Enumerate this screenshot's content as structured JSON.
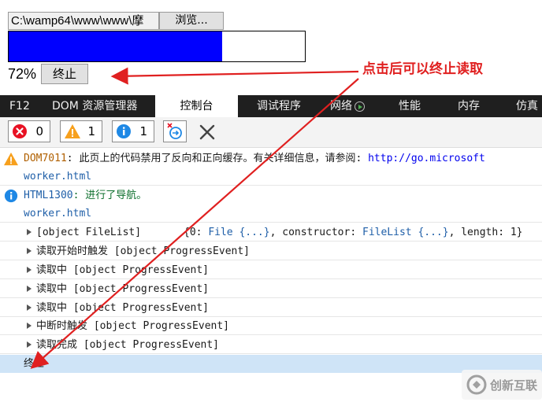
{
  "page": {
    "file_path": "C:\\wamp64\\www\\www\\摩",
    "browse_label": "浏览...",
    "progress_fraction": 0.72,
    "percent_text": "72%",
    "stop_label": "终止",
    "annotation": "点击后可以终止读取"
  },
  "devtools": {
    "tabs": [
      {
        "label": "F12"
      },
      {
        "label": "DOM 资源管理器"
      },
      {
        "label": "控制台"
      },
      {
        "label": "调试程序"
      },
      {
        "label": "网络"
      },
      {
        "label": "性能"
      },
      {
        "label": "内存"
      },
      {
        "label": "仿真"
      }
    ],
    "toolbar": {
      "errors": "0",
      "warnings": "1",
      "messages": "1"
    }
  },
  "console": {
    "warn": {
      "code": "DOM7011",
      "text": ": 此页上的代码禁用了反向和正向缓存。有关详细信息，请参阅: ",
      "link": "http://go.microsoft",
      "source": "worker.html"
    },
    "info": {
      "code": "HTML1300",
      "text": ": 进行了导航。",
      "source": "worker.html"
    },
    "filelist": {
      "left": "[object FileList]",
      "right_prefix": "{0: ",
      "file_obj": "File {...}",
      "mid": ", constructor: ",
      "filelist_obj": "FileList {...}",
      "suffix": ", length: 1}"
    },
    "logs": [
      "读取开始时触发 [object ProgressEvent]",
      "读取中 [object ProgressEvent]",
      "读取中 [object ProgressEvent]",
      "读取中 [object ProgressEvent]",
      "中断时触发 [object ProgressEvent]",
      "读取完成 [object ProgressEvent]"
    ],
    "last": "终止"
  },
  "watermark": "创新互联",
  "colors": {
    "progress": "#0000ff",
    "annotation": "#e02020",
    "tabbar": "#1f1f1f"
  }
}
